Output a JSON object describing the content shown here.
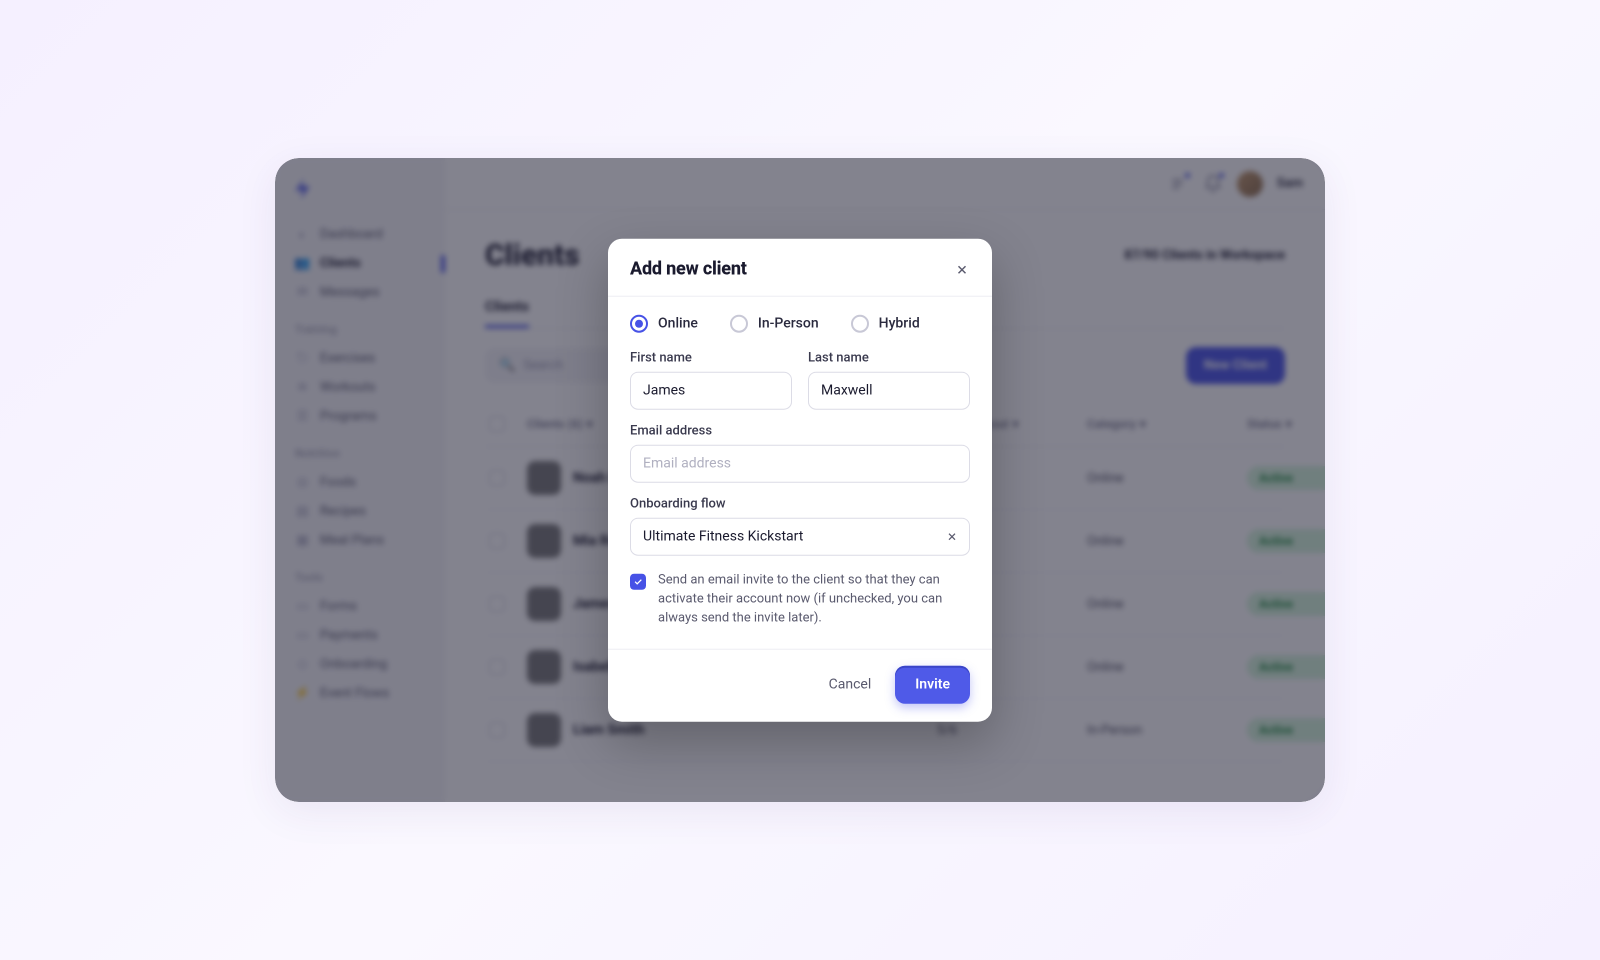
{
  "topbar": {
    "username": "Sam"
  },
  "sidebar": {
    "main": [
      {
        "label": "Dashboard"
      },
      {
        "label": "Clients"
      },
      {
        "label": "Messages"
      }
    ],
    "sections": [
      {
        "title": "Training",
        "items": [
          {
            "label": "Exercises"
          },
          {
            "label": "Workouts"
          },
          {
            "label": "Programs"
          }
        ]
      },
      {
        "title": "Nutrition",
        "items": [
          {
            "label": "Foods"
          },
          {
            "label": "Recipes"
          },
          {
            "label": "Meal Plans"
          }
        ]
      },
      {
        "title": "Tools",
        "items": [
          {
            "label": "Forms"
          },
          {
            "label": "Payments"
          },
          {
            "label": "Onboarding"
          },
          {
            "label": "Event Flows"
          }
        ]
      }
    ]
  },
  "page": {
    "title": "Clients",
    "workspace_count": "87/90 Clients in Workspace",
    "tab": "Clients",
    "search_placeholder": "Search",
    "new_client_label": "New Client"
  },
  "table": {
    "columns": [
      "Clients (6)",
      "",
      "Last Workout",
      "Category",
      "Status"
    ],
    "rows": [
      {
        "name": "Noah Davis",
        "last_workout": "",
        "category": "Online",
        "status": "Active"
      },
      {
        "name": "Mia Rodriguez",
        "last_workout": "",
        "category": "Online",
        "status": "Active"
      },
      {
        "name": "James Maxwell",
        "last_workout": "",
        "category": "Online",
        "status": "Active"
      },
      {
        "name": "Isabella Lee",
        "last_workout": "",
        "category": "Online",
        "status": "Active"
      },
      {
        "name": "Liam Smith",
        "last_workout": "5/6",
        "category": "In-Person",
        "status": "Active"
      }
    ]
  },
  "modal": {
    "title": "Add new client",
    "radios": [
      {
        "label": "Online",
        "selected": true
      },
      {
        "label": "In-Person",
        "selected": false
      },
      {
        "label": "Hybrid",
        "selected": false
      }
    ],
    "first_name_label": "First name",
    "first_name_value": "James",
    "last_name_label": "Last name",
    "last_name_value": "Maxwell",
    "email_label": "Email address",
    "email_placeholder": "Email address",
    "email_value": "",
    "onboarding_label": "Onboarding flow",
    "onboarding_value": "Ultimate Fitness Kickstart",
    "checkbox_text": "Send an email invite to the client so that they can activate their account now (if unchecked, you can always send the invite later).",
    "cancel": "Cancel",
    "invite": "Invite"
  }
}
